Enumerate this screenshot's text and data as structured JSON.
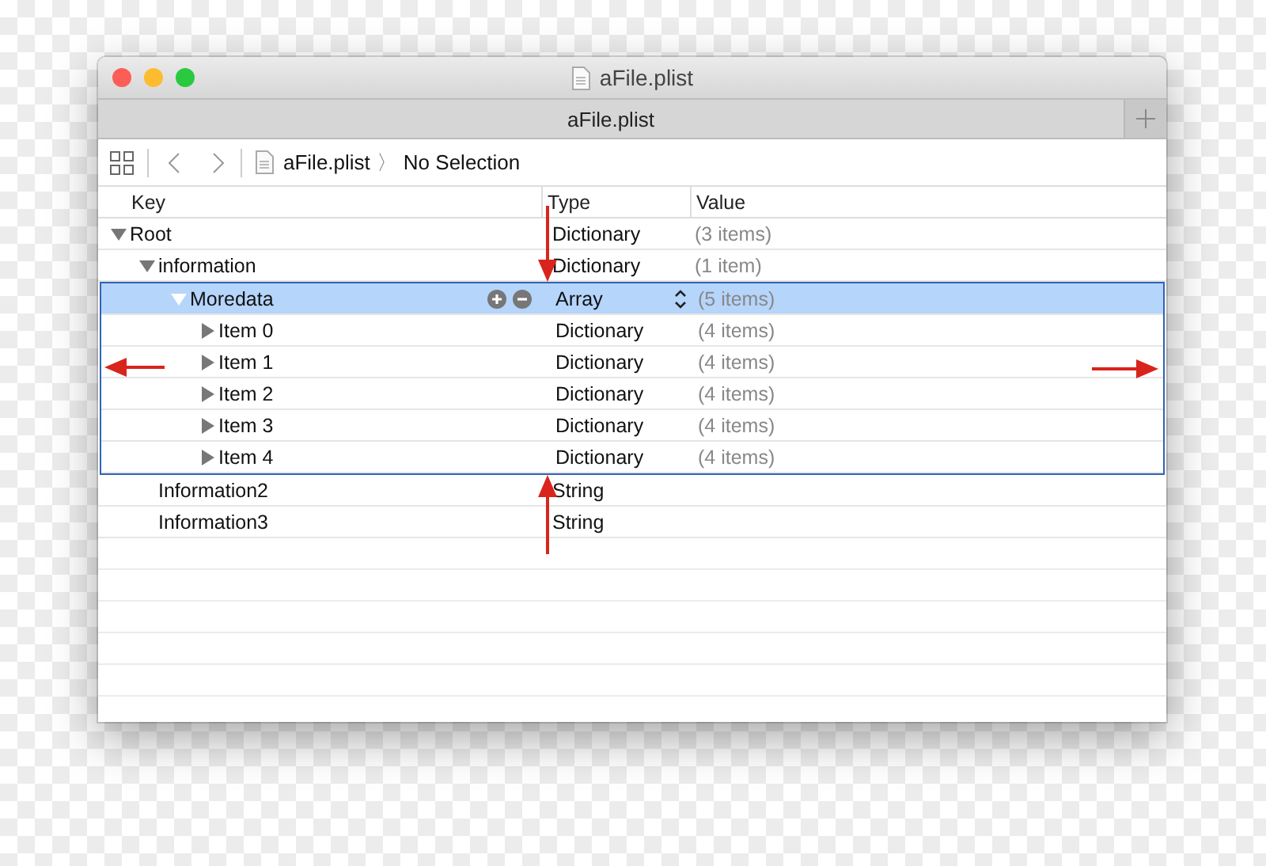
{
  "window": {
    "title": "aFile.plist"
  },
  "tabs": [
    {
      "label": "aFile.plist",
      "selected": true
    }
  ],
  "breadcrumb": {
    "file": "aFile.plist",
    "separator": "〉",
    "selection": "No Selection"
  },
  "table": {
    "columns": [
      "Key",
      "Type",
      "Value"
    ],
    "rows": [
      {
        "key": "Root",
        "type": "Dictionary",
        "value": "(3 items)",
        "expanded": true,
        "selected": false,
        "children": [
          {
            "key": "information",
            "type": "Dictionary",
            "value": "(1 item)",
            "expanded": true,
            "selected": false,
            "children": [
              {
                "key": "Moredata",
                "type": "Array",
                "value": "(5 items)",
                "expanded": true,
                "selected": true,
                "children": [
                  {
                    "key": "Item 0",
                    "type": "Dictionary",
                    "value": "(4 items)",
                    "expanded": false,
                    "selected": false
                  },
                  {
                    "key": "Item 1",
                    "type": "Dictionary",
                    "value": "(4 items)",
                    "expanded": false,
                    "selected": false
                  },
                  {
                    "key": "Item 2",
                    "type": "Dictionary",
                    "value": "(4 items)",
                    "expanded": false,
                    "selected": false
                  },
                  {
                    "key": "Item 3",
                    "type": "Dictionary",
                    "value": "(4 items)",
                    "expanded": false,
                    "selected": false
                  },
                  {
                    "key": "Item 4",
                    "type": "Dictionary",
                    "value": "(4 items)",
                    "expanded": false,
                    "selected": false
                  }
                ]
              }
            ]
          },
          {
            "key": "Information2",
            "type": "String",
            "selected": false
          },
          {
            "key": "Information3",
            "type": "String",
            "selected": false
          }
        ]
      }
    ]
  }
}
